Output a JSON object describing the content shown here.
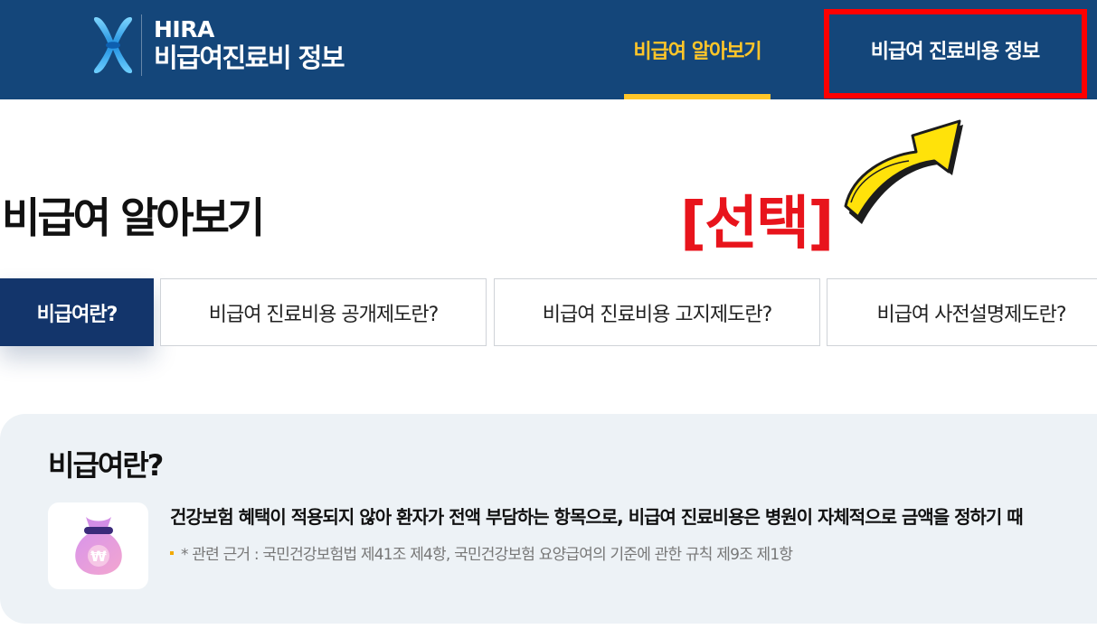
{
  "header": {
    "logo_line1": "HIRA",
    "logo_line2": "비급여진료비 정보",
    "nav": [
      "비급여 알아보기",
      "비급여 진료비용 정보"
    ],
    "brand_bg": "#14467a",
    "active_color": "#ffc629"
  },
  "annotation": {
    "label": "[선택]",
    "highlight_color": "#ff0000"
  },
  "page": {
    "title": "비급여 알아보기"
  },
  "tabs": [
    "비급여란?",
    "비급여 진료비용 공개제도란?",
    "비급여 진료비용 고지제도란?",
    "비급여 사전설명제도란?"
  ],
  "card": {
    "title": "비급여란?",
    "description": "건강보험 혜택이 적용되지 않아 환자가 전액 부담하는 항목으로, 비급여 진료비용은 병원이 자체적으로 금액을 정하기 때",
    "basis": "* 관련 근거 : 국민건강보험법 제41조 제4항, 국민건강보험 요양급여의 기준에 관한 규칙 제9조 제1항",
    "icon": "money-bag-icon"
  }
}
